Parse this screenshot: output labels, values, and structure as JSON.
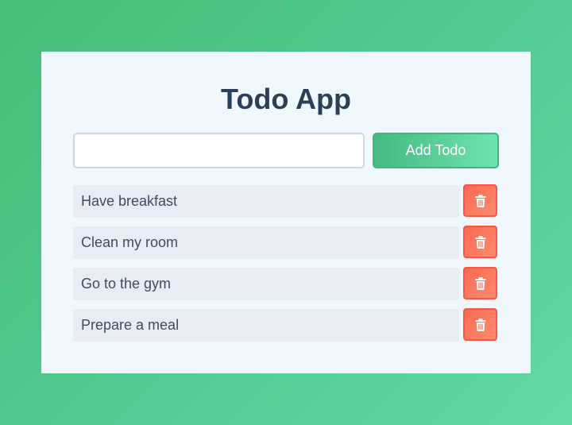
{
  "app": {
    "title": "Todo App",
    "accent_color": "#48bb78",
    "delete_color": "#f86a52"
  },
  "form": {
    "input_value": "",
    "input_placeholder": "",
    "add_button_label": "Add Todo"
  },
  "todos": [
    {
      "text": "Have breakfast",
      "delete_icon": "trash-icon"
    },
    {
      "text": "Clean my room",
      "delete_icon": "trash-icon"
    },
    {
      "text": "Go to the gym",
      "delete_icon": "trash-icon"
    },
    {
      "text": "Prepare a meal",
      "delete_icon": "trash-icon"
    }
  ]
}
